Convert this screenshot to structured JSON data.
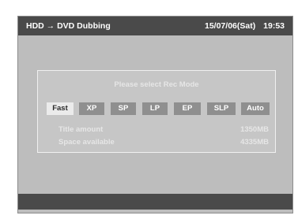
{
  "header": {
    "title": "HDD → DVD Dubbing",
    "date": "15/07/06(Sat)",
    "time": "19:53"
  },
  "dialog": {
    "prompt": "Please select Rec Mode",
    "modes": [
      {
        "label": "Fast",
        "selected": true
      },
      {
        "label": "XP",
        "selected": false
      },
      {
        "label": "SP",
        "selected": false
      },
      {
        "label": "LP",
        "selected": false
      },
      {
        "label": "EP",
        "selected": false
      },
      {
        "label": "SLP",
        "selected": false
      },
      {
        "label": "Auto",
        "selected": false
      }
    ],
    "info": [
      {
        "label": "Title amount",
        "value": "1350MB"
      },
      {
        "label": "Space available",
        "value": "4335MB"
      }
    ]
  },
  "colors": {
    "screen_bg": "#bdbdbd",
    "bar_bg": "#4a4a4a",
    "mode_selected_bg": "#ebebeb",
    "mode_bg": "#8f8f8f",
    "text_light": "#e6e6e6"
  }
}
